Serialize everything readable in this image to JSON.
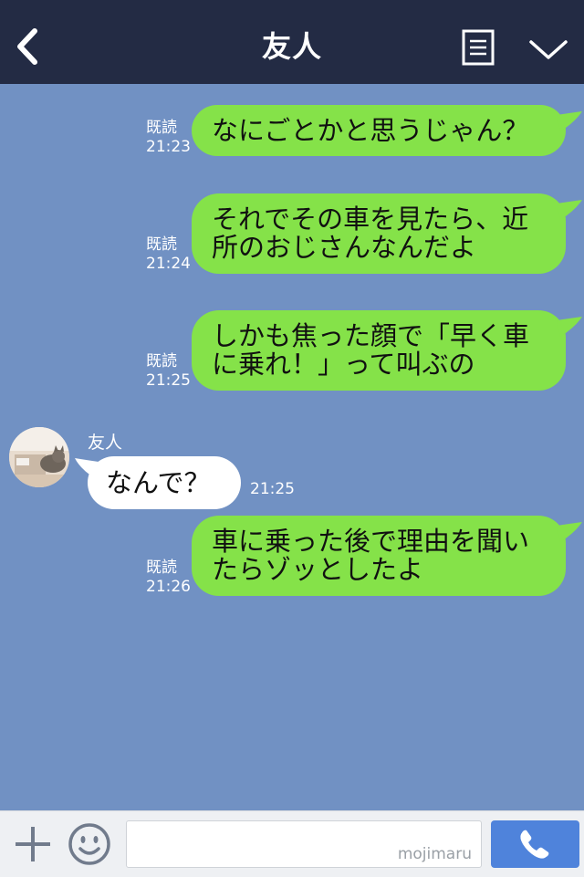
{
  "header": {
    "title": "友人",
    "back_icon": "chevron-left-icon",
    "menu_icon": "list-icon",
    "collapse_icon": "chevron-down-icon"
  },
  "messages": [
    {
      "side": "out",
      "text_lines": [
        "なにごとかと思うじゃん？"
      ],
      "read": "既読",
      "time": "21:23"
    },
    {
      "side": "out",
      "text_lines": [
        "それでその車を見たら、近",
        "所のおじさんなんだよ"
      ],
      "read": "既読",
      "time": "21:24"
    },
    {
      "side": "out",
      "text_lines": [
        "しかも焦った顔で「早く車",
        "に乗れ！」って叫ぶの"
      ],
      "read": "既読",
      "time": "21:25"
    },
    {
      "side": "in",
      "sender": "友人",
      "text_lines": [
        "なんで？"
      ],
      "time": "21:25"
    },
    {
      "side": "out",
      "text_lines": [
        "車に乗った後で理由を聞い",
        "たらゾッとしたよ"
      ],
      "read": "既読",
      "time": "21:26"
    }
  ],
  "input": {
    "placeholder": "",
    "watermark": "mojimaru"
  },
  "colors": {
    "background": "#7191c3",
    "header": "#232b44",
    "bubble_out": "#85e249",
    "bubble_in": "#ffffff",
    "call_button": "#4f83db"
  }
}
